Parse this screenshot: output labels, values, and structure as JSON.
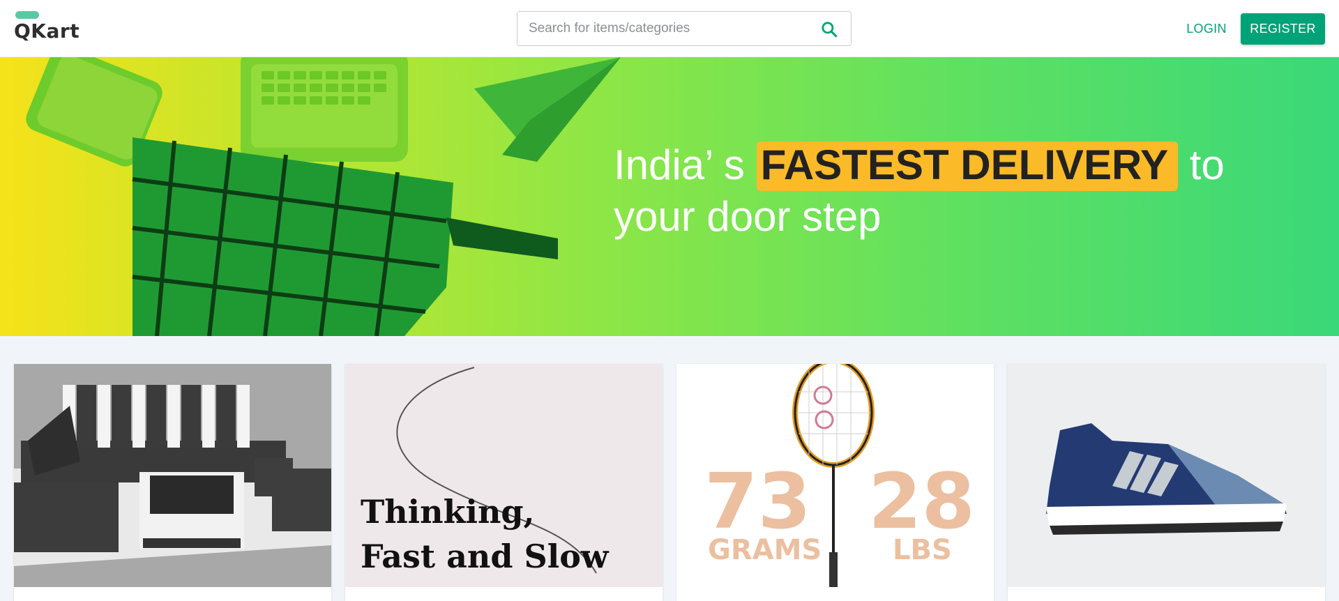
{
  "header": {
    "logo_text": "QKart",
    "search": {
      "placeholder": "Search for items/categories",
      "icon": "search-icon"
    },
    "login_label": "LOGIN",
    "register_label": "REGISTER"
  },
  "hero": {
    "text_before": "India’ s ",
    "highlight": "FASTEST DELIVERY",
    "text_after": " to your door step"
  },
  "products": [
    {
      "kind": "sofa-image"
    },
    {
      "kind": "book-cover",
      "cover_text_line1": "Thinking,",
      "cover_text_line2": "Fast and Slow"
    },
    {
      "kind": "badminton-racket-image",
      "left_number": "73",
      "left_unit": "GRAMS",
      "right_number": "28",
      "right_unit": "LBS"
    },
    {
      "kind": "shoe-image"
    }
  ],
  "colors": {
    "accent": "#00a278",
    "highlight": "#fbba27",
    "background": "#f1f5f9"
  }
}
